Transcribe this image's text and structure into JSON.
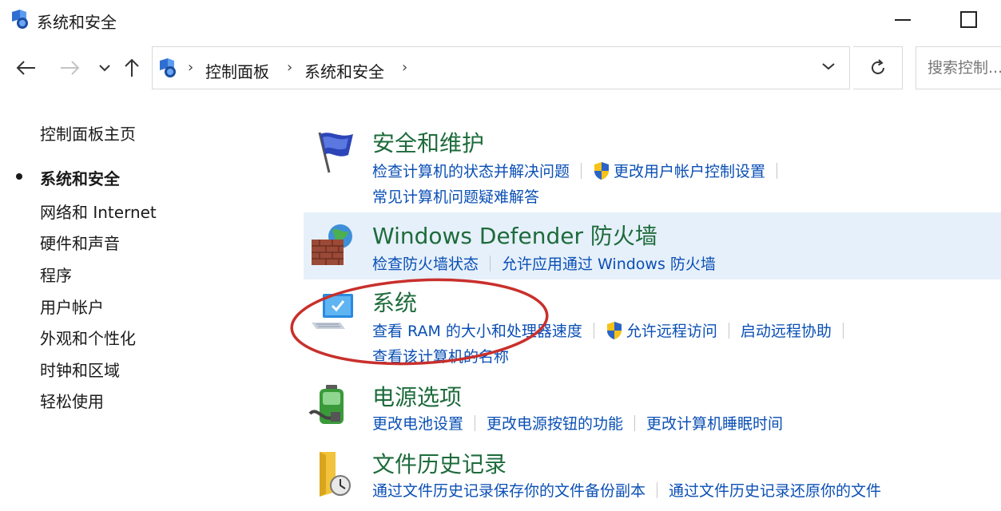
{
  "window": {
    "title": "系统和安全"
  },
  "address": {
    "crumbs": [
      "控制面板",
      "系统和安全"
    ],
    "search_placeholder": "搜索控制..."
  },
  "sidebar": {
    "items": [
      {
        "label": "控制面板主页",
        "active": false
      },
      {
        "label": "系统和安全",
        "active": true
      },
      {
        "label": "网络和 Internet",
        "active": false
      },
      {
        "label": "硬件和声音",
        "active": false
      },
      {
        "label": "程序",
        "active": false
      },
      {
        "label": "用户帐户",
        "active": false
      },
      {
        "label": "外观和个性化",
        "active": false
      },
      {
        "label": "时钟和区域",
        "active": false
      },
      {
        "label": "轻松使用",
        "active": false
      }
    ]
  },
  "categories": [
    {
      "title": "安全和维护",
      "icon": "flag-icon",
      "links_row1": [
        "检查计算机的状态并解决问题",
        "更改用户帐户控制设置"
      ],
      "links_row2": [
        "常见计算机问题疑难解答"
      ]
    },
    {
      "title": "Windows Defender 防火墙",
      "icon": "firewall-icon",
      "links_row1": [
        "检查防火墙状态",
        "允许应用通过 Windows 防火墙"
      ]
    },
    {
      "title": "系统",
      "icon": "computer-icon",
      "links_row1": [
        "查看 RAM 的大小和处理器速度",
        "允许远程访问",
        "启动远程协助"
      ],
      "links_row2": [
        "查看该计算机的名称"
      ]
    },
    {
      "title": "电源选项",
      "icon": "battery-icon",
      "links_row1": [
        "更改电池设置",
        "更改电源按钮的功能",
        "更改计算机睡眠时间"
      ]
    },
    {
      "title": "文件历史记录",
      "icon": "file-history-icon",
      "links_row1": [
        "通过文件历史记录保存你的文件备份副本",
        "通过文件历史记录还原你的文件"
      ]
    }
  ],
  "colors": {
    "link": "#0a4fb5",
    "category_title": "#1e6b3c",
    "highlight_bg": "#e6f0fa",
    "annotation": "#c8302c"
  }
}
